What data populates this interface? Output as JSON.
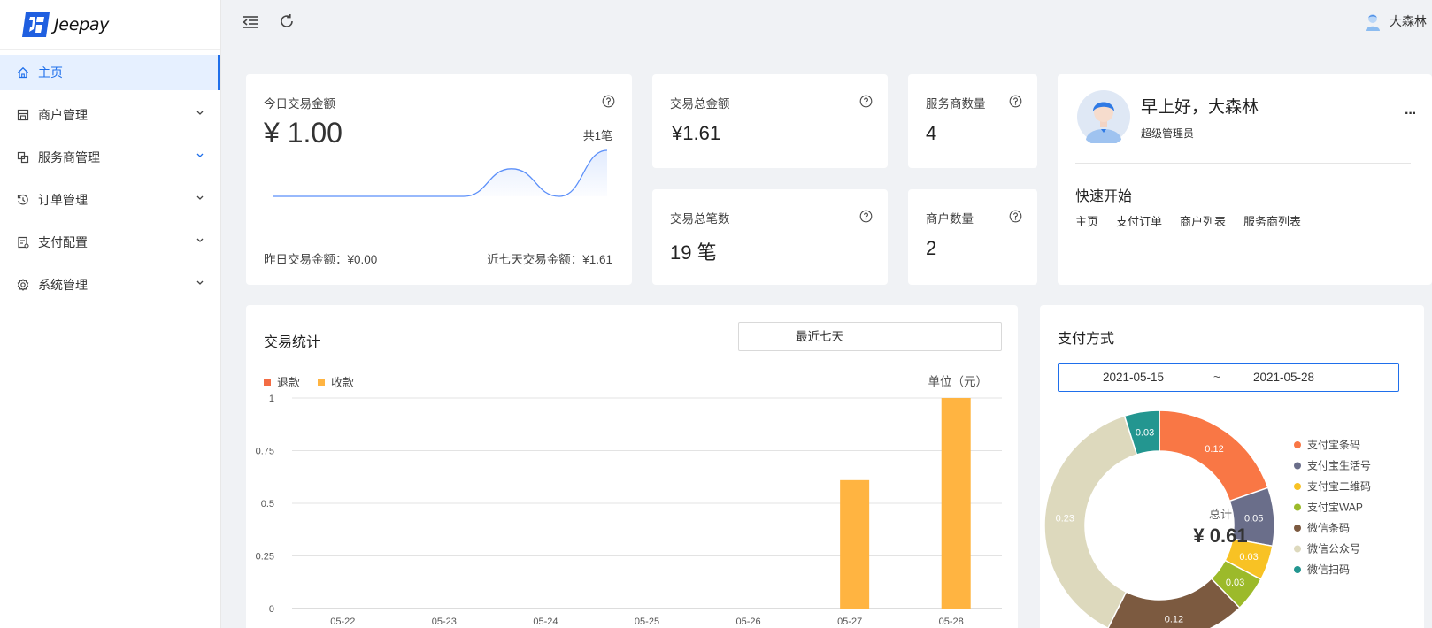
{
  "app": {
    "name": "Jeepay"
  },
  "sidebar": {
    "items": [
      {
        "label": "主页",
        "icon": "home-icon",
        "active": true,
        "expandable": false
      },
      {
        "label": "商户管理",
        "icon": "store-icon",
        "active": false,
        "expandable": true
      },
      {
        "label": "服务商管理",
        "icon": "copy-icon",
        "active": false,
        "expandable": true
      },
      {
        "label": "订单管理",
        "icon": "history-icon",
        "active": false,
        "expandable": true
      },
      {
        "label": "支付配置",
        "icon": "config-icon",
        "active": false,
        "expandable": true
      },
      {
        "label": "系统管理",
        "icon": "gear-icon",
        "active": false,
        "expandable": true
      }
    ]
  },
  "header": {
    "user_name": "大森林"
  },
  "today": {
    "label": "今日交易金额",
    "amount": "¥ 1.00",
    "count": "共1笔",
    "yesterday": "昨日交易金额：¥0.00",
    "seven_days": "近七天交易金额：¥1.61"
  },
  "total_amount": {
    "label": "交易总金额",
    "value": "¥1.61"
  },
  "total_count": {
    "label": "交易总笔数",
    "value": "19 笔"
  },
  "service_count": {
    "label": "服务商数量",
    "value": "4"
  },
  "merchant_count": {
    "label": "商户数量",
    "value": "2"
  },
  "welcome": {
    "greeting": "早上好，大森林",
    "role": "超级管理员",
    "more": "···",
    "quick_title": "快速开始",
    "links": [
      "主页",
      "支付订单",
      "商户列表",
      "服务商列表"
    ]
  },
  "trade_stats": {
    "title": "交易统计",
    "range": "最近七天",
    "unit": "单位（元）"
  },
  "pay_method": {
    "title": "支付方式",
    "date_from": "2021-05-15",
    "date_sep": "~",
    "date_to": "2021-05-28",
    "total_label": "总计",
    "total_value": "¥ 0.61"
  },
  "chart_data": [
    {
      "type": "area",
      "series": [
        {
          "values": [
            0,
            0,
            0,
            0,
            0,
            0.6,
            0,
            1
          ]
        }
      ]
    },
    {
      "type": "bar",
      "categories": [
        "05-22",
        "05-23",
        "05-24",
        "05-25",
        "05-26",
        "05-27",
        "05-28"
      ],
      "series": [
        {
          "name": "退款",
          "color": "#f36c44",
          "values": [
            0,
            0,
            0,
            0,
            0,
            0,
            0
          ]
        },
        {
          "name": "收款",
          "color": "#ffb441",
          "values": [
            0,
            0,
            0,
            0,
            0,
            0.61,
            1
          ]
        }
      ],
      "yticks": [
        "1",
        "0.75",
        "0.5",
        "0.25",
        "0"
      ],
      "ylim": [
        0,
        1
      ],
      "legend": "top-left"
    },
    {
      "type": "pie",
      "series": [
        {
          "name": "支付宝条码",
          "value": 0.12,
          "color": "#f97745"
        },
        {
          "name": "支付宝生活号",
          "value": 0.05,
          "color": "#6a6e8a"
        },
        {
          "name": "支付宝二维码",
          "value": 0.03,
          "color": "#f8c224"
        },
        {
          "name": "支付宝WAP",
          "value": 0.03,
          "color": "#9cba2a"
        },
        {
          "name": "微信条码",
          "value": 0.12,
          "color": "#7c5a40"
        },
        {
          "name": "微信公众号",
          "value": 0.23,
          "color": "#ddd9bd"
        },
        {
          "name": "微信扫码",
          "value": 0.03,
          "color": "#239690"
        }
      ],
      "legend": "right"
    }
  ]
}
